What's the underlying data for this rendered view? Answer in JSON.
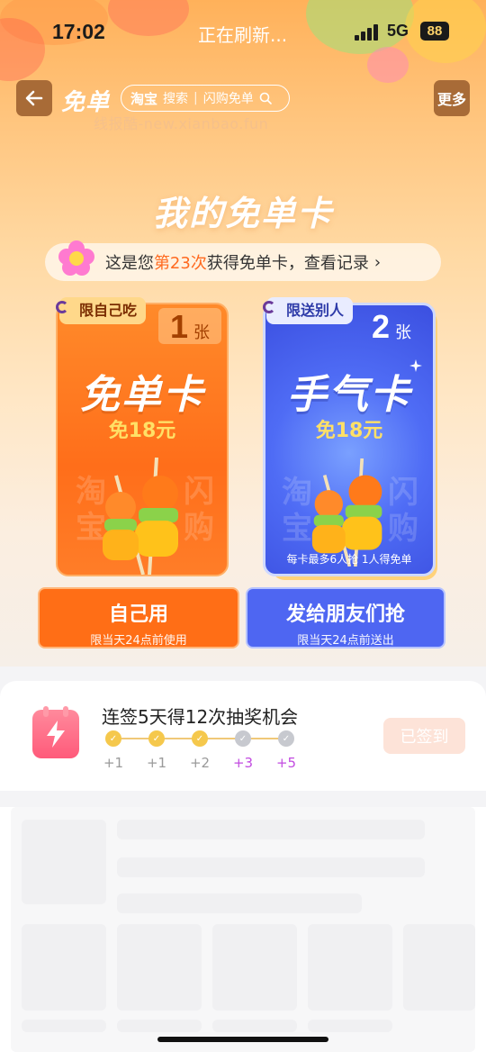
{
  "status_bar": {
    "time": "17:02",
    "title": "正在刷新...",
    "network": "5G",
    "battery": "88"
  },
  "nav": {
    "back_icon": "back-arrow-icon",
    "title": "免单",
    "search": {
      "brand": "淘宝",
      "label": "搜索",
      "hint": "闪购免单"
    },
    "more_label": "更多"
  },
  "watermark": "线报酷-new.xianbao.fun",
  "hero": {
    "title": "我的免单卡",
    "record": {
      "prefix": "这是您",
      "highlight": "第23次",
      "suffix": "获得免单卡，查看记录",
      "chevron": "›"
    }
  },
  "cards": [
    {
      "tag": "限自己吃",
      "count": "1",
      "unit": "张",
      "name": "免单卡",
      "amount": "免18元",
      "note": "",
      "action_main": "自己用",
      "action_sub": "限当天24点前使用"
    },
    {
      "tag": "限送别人",
      "count": "2",
      "unit": "张",
      "name": "手气卡",
      "amount": "免18元",
      "note": "每卡最多6人抢 1人得免单",
      "action_main": "发给朋友们抢",
      "action_sub": "限当天24点前送出"
    }
  ],
  "signin": {
    "icon": "calendar-lightning-icon",
    "title": "连签5天得12次抽奖机会",
    "days": [
      {
        "label": "+1",
        "done": true
      },
      {
        "label": "+1",
        "done": true
      },
      {
        "label": "+2",
        "done": true
      },
      {
        "label": "+3",
        "done": false
      },
      {
        "label": "+5",
        "done": false
      }
    ],
    "button_label": "已签到"
  },
  "colors": {
    "accent_orange": "#ff6e16",
    "accent_blue": "#4e66f2",
    "highlight": "#ff6a1f",
    "purple": "#c24be0"
  }
}
